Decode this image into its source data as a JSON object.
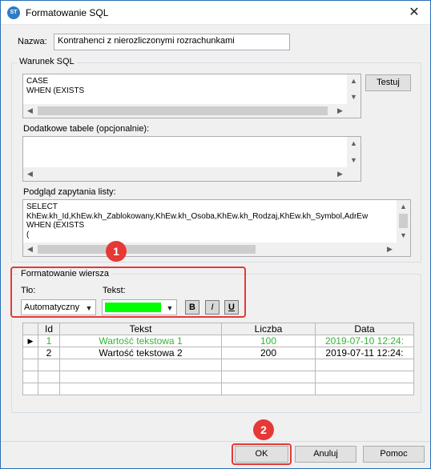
{
  "window": {
    "title": "Formatowanie SQL",
    "app_icon_text": "ST",
    "close_glyph": "✕"
  },
  "name": {
    "label": "Nazwa:",
    "value": "Kontrahenci z nierozliczonymi rozrachunkami"
  },
  "sql_condition": {
    "group_title": "Warunek SQL",
    "text": "CASE\nWHEN (EXISTS",
    "test_button": "Testuj"
  },
  "extra_tables": {
    "label": "Dodatkowe tabele (opcjonalnie):",
    "text": ""
  },
  "query_preview": {
    "label": "Podgląd zapytania listy:",
    "text": "SELECT\nKhEw.kh_Id,KhEw.kh_Zablokowany,KhEw.kh_Osoba,KhEw.kh_Rodzaj,KhEw.kh_Symbol,AdrEw\nWHEN (EXISTS\n("
  },
  "row_format": {
    "group_title": "Formatowanie wiersza",
    "background_label": "Tło:",
    "background_value": "Automatyczny",
    "text_label": "Tekst:",
    "text_color": "#00ff00",
    "bold_label": "B",
    "italic_label": "I",
    "underline_label": "U"
  },
  "grid": {
    "columns": [
      "Id",
      "Tekst",
      "Liczba",
      "Data"
    ],
    "rows": [
      {
        "indicator": "▶",
        "id": "1",
        "text": "Wartość tekstowa 1",
        "number": "100",
        "date": "2019-07-10 12:24:",
        "color": "#2fb82f"
      },
      {
        "indicator": "",
        "id": "2",
        "text": "Wartość tekstowa 2",
        "number": "200",
        "date": "2019-07-11 12:24:",
        "color": "#000000"
      }
    ]
  },
  "annotations": {
    "badge1": "1",
    "badge2": "2",
    "highlight_color": "#e53935"
  },
  "buttons": {
    "ok": "OK",
    "cancel": "Anuluj",
    "help": "Pomoc"
  }
}
